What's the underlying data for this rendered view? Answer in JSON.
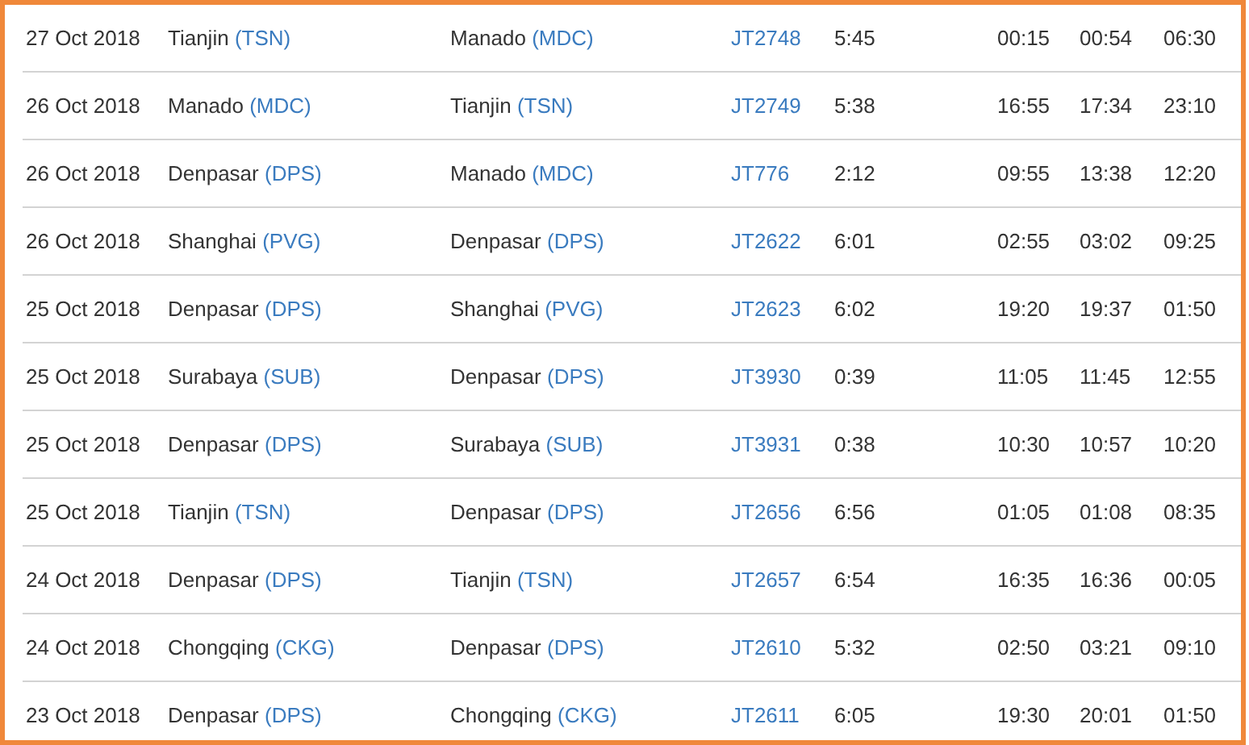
{
  "rows": [
    {
      "date": "27 Oct 2018",
      "from": {
        "city": "Tianjin",
        "code": "(TSN)"
      },
      "to": {
        "city": "Manado",
        "code": "(MDC)"
      },
      "flight": "JT2748",
      "duration": "5:45",
      "time_1": "00:15",
      "time_2": "00:54",
      "time_3": "06:30"
    },
    {
      "date": "26 Oct 2018",
      "from": {
        "city": "Manado",
        "code": "(MDC)"
      },
      "to": {
        "city": "Tianjin",
        "code": "(TSN)"
      },
      "flight": "JT2749",
      "duration": "5:38",
      "time_1": "16:55",
      "time_2": "17:34",
      "time_3": "23:10"
    },
    {
      "date": "26 Oct 2018",
      "from": {
        "city": "Denpasar",
        "code": "(DPS)"
      },
      "to": {
        "city": "Manado",
        "code": "(MDC)"
      },
      "flight": "JT776",
      "duration": "2:12",
      "time_1": "09:55",
      "time_2": "13:38",
      "time_3": "12:20"
    },
    {
      "date": "26 Oct 2018",
      "from": {
        "city": "Shanghai",
        "code": "(PVG)"
      },
      "to": {
        "city": "Denpasar",
        "code": "(DPS)"
      },
      "flight": "JT2622",
      "duration": "6:01",
      "time_1": "02:55",
      "time_2": "03:02",
      "time_3": "09:25"
    },
    {
      "date": "25 Oct 2018",
      "from": {
        "city": "Denpasar",
        "code": "(DPS)"
      },
      "to": {
        "city": "Shanghai",
        "code": "(PVG)"
      },
      "flight": "JT2623",
      "duration": "6:02",
      "time_1": "19:20",
      "time_2": "19:37",
      "time_3": "01:50"
    },
    {
      "date": "25 Oct 2018",
      "from": {
        "city": "Surabaya",
        "code": "(SUB)"
      },
      "to": {
        "city": "Denpasar",
        "code": "(DPS)"
      },
      "flight": "JT3930",
      "duration": "0:39",
      "time_1": "11:05",
      "time_2": "11:45",
      "time_3": "12:55"
    },
    {
      "date": "25 Oct 2018",
      "from": {
        "city": "Denpasar",
        "code": "(DPS)"
      },
      "to": {
        "city": "Surabaya",
        "code": "(SUB)"
      },
      "flight": "JT3931",
      "duration": "0:38",
      "time_1": "10:30",
      "time_2": "10:57",
      "time_3": "10:20"
    },
    {
      "date": "25 Oct 2018",
      "from": {
        "city": "Tianjin",
        "code": "(TSN)"
      },
      "to": {
        "city": "Denpasar",
        "code": "(DPS)"
      },
      "flight": "JT2656",
      "duration": "6:56",
      "time_1": "01:05",
      "time_2": "01:08",
      "time_3": "08:35"
    },
    {
      "date": "24 Oct 2018",
      "from": {
        "city": "Denpasar",
        "code": "(DPS)"
      },
      "to": {
        "city": "Tianjin",
        "code": "(TSN)"
      },
      "flight": "JT2657",
      "duration": "6:54",
      "time_1": "16:35",
      "time_2": "16:36",
      "time_3": "00:05"
    },
    {
      "date": "24 Oct 2018",
      "from": {
        "city": "Chongqing",
        "code": "(CKG)"
      },
      "to": {
        "city": "Denpasar",
        "code": "(DPS)"
      },
      "flight": "JT2610",
      "duration": "5:32",
      "time_1": "02:50",
      "time_2": "03:21",
      "time_3": "09:10"
    },
    {
      "date": "23 Oct 2018",
      "from": {
        "city": "Denpasar",
        "code": "(DPS)"
      },
      "to": {
        "city": "Chongqing",
        "code": "(CKG)"
      },
      "flight": "JT2611",
      "duration": "6:05",
      "time_1": "19:30",
      "time_2": "20:01",
      "time_3": "01:50"
    }
  ]
}
